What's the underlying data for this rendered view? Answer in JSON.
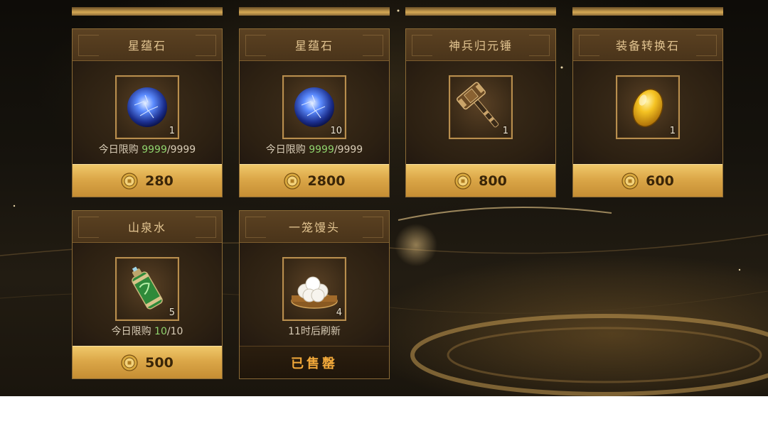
{
  "shop": {
    "items": [
      {
        "name": "星蕴石",
        "icon": "blue-star-orb-icon",
        "quantity": "1",
        "limit_label": "今日限购",
        "limit_current": "9999",
        "limit_max": "/9999",
        "price": "280"
      },
      {
        "name": "星蕴石",
        "icon": "blue-star-orb-icon",
        "quantity": "10",
        "limit_label": "今日限购",
        "limit_current": "9999",
        "limit_max": "/9999",
        "price": "2800"
      },
      {
        "name": "神兵归元锤",
        "icon": "hammer-icon",
        "quantity": "1",
        "price": "800"
      },
      {
        "name": "装备转换石",
        "icon": "amber-gem-icon",
        "quantity": "1",
        "price": "600"
      },
      {
        "name": "山泉水",
        "icon": "water-canister-icon",
        "quantity": "5",
        "limit_label": "今日限购",
        "limit_current": "10",
        "limit_max": "/10",
        "price": "500"
      },
      {
        "name": "一笼馒头",
        "icon": "steamed-buns-icon",
        "quantity": "4",
        "refresh_text": "11时后刷新",
        "sold_out_label": "已售罄"
      }
    ],
    "currency_icon": "gold-coin-icon"
  },
  "colors": {
    "title_text": "#e3c591",
    "limit_green": "#8fd36d",
    "price_bar_gold": "#dba748",
    "sold_out_text": "#f2a93a"
  }
}
